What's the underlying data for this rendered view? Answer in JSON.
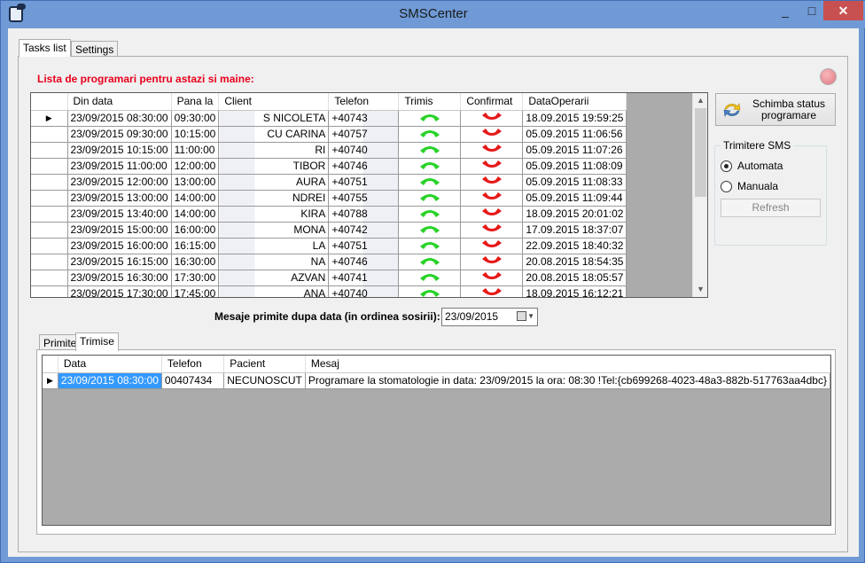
{
  "window": {
    "title": "SMSCenter",
    "min_glyph": "_",
    "max_glyph": "□",
    "close_glyph": "✕"
  },
  "tabs": {
    "tasks": "Tasks list",
    "settings": "Settings"
  },
  "tasks": {
    "heading": "Lista de programari pentru astazi si maine:",
    "columns": [
      "Din data",
      "Pana la",
      "Client",
      "Telefon",
      "Trimis",
      "Confirmat",
      "DataOperarii"
    ],
    "rows": [
      {
        "din": "23/09/2015 08:30:00",
        "pana": "09:30:00",
        "client": "S NICOLETA",
        "tel": "+40743",
        "op": "18.09.2015 19:59:25"
      },
      {
        "din": "23/09/2015 09:30:00",
        "pana": "10:15:00",
        "client": "CU CARINA",
        "tel": "+40757",
        "op": "05.09.2015 11:06:56"
      },
      {
        "din": "23/09/2015 10:15:00",
        "pana": "11:00:00",
        "client": "RI",
        "tel": "+40740",
        "op": "05.09.2015 11:07:26"
      },
      {
        "din": "23/09/2015 11:00:00",
        "pana": "12:00:00",
        "client": "TIBOR",
        "tel": "+40746",
        "op": "05.09.2015 11:08:09"
      },
      {
        "din": "23/09/2015 12:00:00",
        "pana": "13:00:00",
        "client": "AURA",
        "tel": "+40751",
        "op": "05.09.2015 11:08:33"
      },
      {
        "din": "23/09/2015 13:00:00",
        "pana": "14:00:00",
        "client": "NDREI",
        "tel": "+40755",
        "op": "05.09.2015 11:09:44"
      },
      {
        "din": "23/09/2015 13:40:00",
        "pana": "14:00:00",
        "client": "KIRA",
        "tel": "+40788",
        "op": "18.09.2015 20:01:02"
      },
      {
        "din": "23/09/2015 15:00:00",
        "pana": "16:00:00",
        "client": "MONA",
        "tel": "+40742",
        "op": "17.09.2015 18:37:07"
      },
      {
        "din": "23/09/2015 16:00:00",
        "pana": "16:15:00",
        "client": "LA",
        "tel": "+40751",
        "op": "22.09.2015 18:40:32"
      },
      {
        "din": "23/09/2015 16:15:00",
        "pana": "16:30:00",
        "client": "NA",
        "tel": "+40746",
        "op": "20.08.2015 18:54:35"
      },
      {
        "din": "23/09/2015 16:30:00",
        "pana": "17:30:00",
        "client": "AZVAN",
        "tel": "+40741",
        "op": "20.08.2015 18:05:57"
      },
      {
        "din": "23/09/2015 17:30:00",
        "pana": "17:45:00",
        "client": "ANA",
        "tel": "+40740",
        "op": "18.09.2015 16:12:21"
      }
    ],
    "trimis_color": "#27d327",
    "confirmat_color": "#e61919"
  },
  "side": {
    "status_button": "Schimba status programare",
    "group_title": "Trimitere SMS",
    "radio_auto": "Automata",
    "radio_manual": "Manuala",
    "selected": "Automata",
    "refresh": "Refresh"
  },
  "messages": {
    "label": "Mesaje primite dupa data (in ordinea sosirii):",
    "date": "23/09/2015",
    "tabs": {
      "primite": "Primite",
      "trimise": "Trimise"
    },
    "columns": [
      "Data",
      "Telefon",
      "Pacient",
      "Mesaj"
    ],
    "rows": [
      {
        "data": "23/09/2015 08:30:00",
        "tel": "00407434",
        "pacient": "NECUNOSCUT",
        "mesaj": "Programare la stomatologie in data: 23/09/2015 la ora: 08:30 !Tel:{cb699268-4023-48a3-882b-517763aa4dbc}"
      }
    ]
  }
}
